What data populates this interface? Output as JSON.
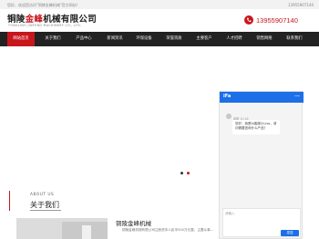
{
  "topbar": {
    "welcome": "您好，欢迎您访问\"铜陵金峰机械\"官方网站！",
    "tel": "13955907140"
  },
  "header": {
    "logo_cn_part1": "铜陵",
    "logo_cn_brand": "金峰",
    "logo_cn_part2": "机械有限公司",
    "logo_en": "TONGLING JINFENG MACHINERY CO., LTD.",
    "phone": "13955907140"
  },
  "nav": {
    "items": [
      {
        "label": "网站首页"
      },
      {
        "label": "关于我们"
      },
      {
        "label": "产品中心"
      },
      {
        "label": "新闻资讯"
      },
      {
        "label": "环保设备"
      },
      {
        "label": "荣誉资质"
      },
      {
        "label": "主要客户"
      },
      {
        "label": "人才招聘"
      },
      {
        "label": "销售网络"
      },
      {
        "label": "联系我们"
      }
    ],
    "active_index": 0
  },
  "about": {
    "en": "ABOUT US",
    "cn": "关于我们",
    "company_name": "铜陵金峰机械",
    "intro": "铜陵金峰机械有限公司注册资本人民币500万元整。主要从事..."
  },
  "chat": {
    "logo": "iFa",
    "minimize": "—",
    "time": "客服 10:18",
    "message": "您好，我是AI客服小Lisa，请问需要咨询什么产品？",
    "input_placeholder": "请输入",
    "send_label": "发送"
  },
  "colors": {
    "brand_red": "#c8161d",
    "nav_bg": "#222222",
    "chat_blue": "#1d6fe8"
  }
}
